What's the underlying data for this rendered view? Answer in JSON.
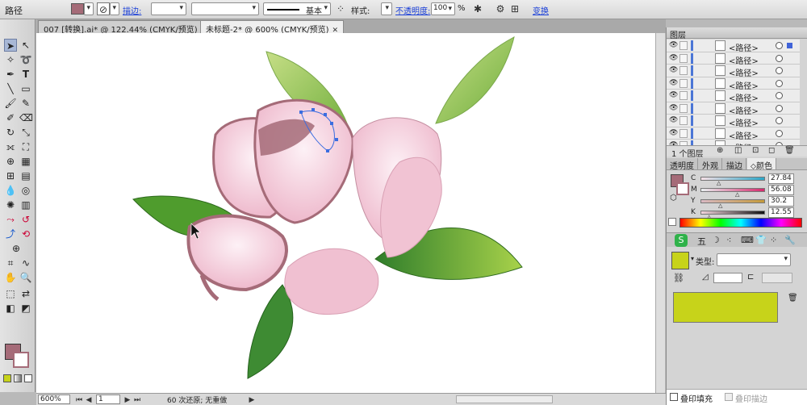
{
  "control_bar": {
    "selection_label": "路径",
    "fill_color": "#a56b78",
    "stroke_label": "描边:",
    "stroke_profile": "基本",
    "style_label": "样式:",
    "opacity_label": "不透明度:",
    "opacity_value": "100",
    "opacity_unit": "%",
    "transform_label": "变换"
  },
  "tabs": [
    {
      "label": "007 [转换].ai* @ 122.44% (CMYK/预览)",
      "active": false
    },
    {
      "label": "未标题-2* @ 600% (CMYK/预览)",
      "active": true
    }
  ],
  "status_bar": {
    "zoom": "600%",
    "artboard": "1",
    "history": "60 次还原; 无重做"
  },
  "layers_panel": {
    "title": "图层",
    "rows": [
      "<路径>",
      "<路径>",
      "<路径>",
      "<路径>",
      "<路径>",
      "<路径>",
      "<路径>",
      "<路径>",
      "<路径>"
    ],
    "footer": "1 个图层"
  },
  "color_panel": {
    "tabs": [
      "透明度",
      "外观",
      "描边",
      "颜色"
    ],
    "active_tab": "颜色",
    "channels": [
      {
        "label": "C",
        "value": "27.84",
        "fraction": 0.2784
      },
      {
        "label": "M",
        "value": "56.08",
        "fraction": 0.5608
      },
      {
        "label": "Y",
        "value": "30.2",
        "fraction": 0.302
      },
      {
        "label": "K",
        "value": "12.55",
        "fraction": 0.1255
      }
    ],
    "fill_color": "#a56b78"
  },
  "graphic_styles": {
    "type_label": "类型:",
    "swatch_color": "#c7d31a"
  },
  "bottom_checks": {
    "overprint_fill": "叠印填充",
    "overprint_stroke": "叠印描边"
  },
  "colors": {
    "petal_light": "#f2c9d8",
    "petal_dark": "#a56b78",
    "leaf_green": "#5aa532",
    "leaf_light": "#b8d978",
    "path_anchor": "#3b6de0"
  }
}
